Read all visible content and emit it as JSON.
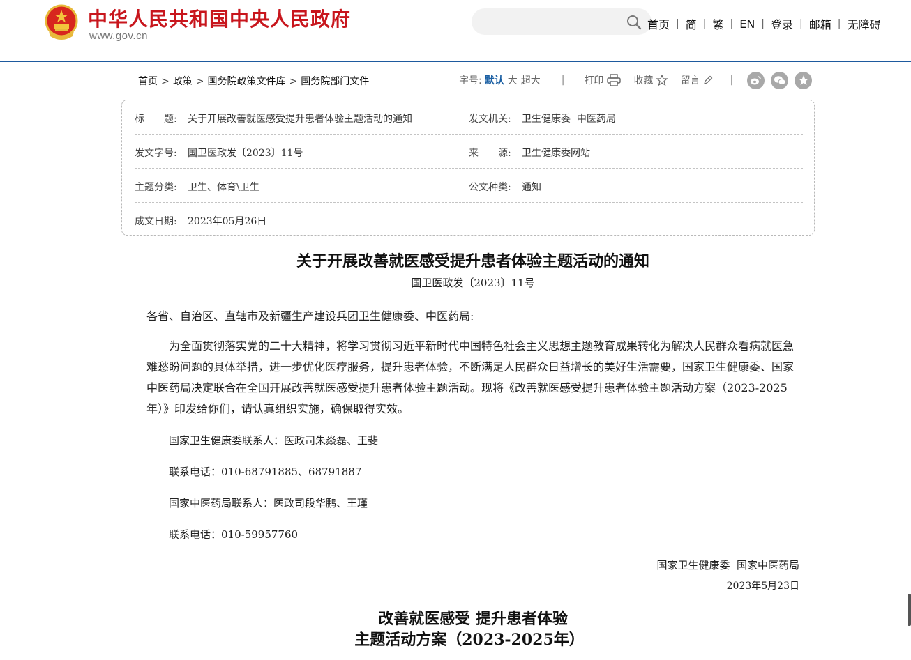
{
  "header": {
    "site_title": "中华人民共和国中央人民政府",
    "site_url": "www.gov.cn",
    "search": {
      "placeholder": ""
    },
    "nav": [
      {
        "label": "首页"
      },
      {
        "label": "简"
      },
      {
        "label": "繁"
      },
      {
        "label": "EN"
      },
      {
        "label": "登录"
      },
      {
        "label": "邮箱"
      },
      {
        "label": "无障碍"
      }
    ]
  },
  "breadcrumb": [
    "首页",
    "政策",
    "国务院政策文件库",
    "国务院部门文件"
  ],
  "toolbar": {
    "font_size_label": "字号:",
    "font_default": "默认",
    "font_large": "大",
    "font_xlarge": "超大",
    "print_label": "打印",
    "favorite_label": "收藏",
    "comment_label": "留言"
  },
  "info": {
    "title_label": "标　　题:",
    "title_value": "关于开展改善就医感受提升患者体验主题活动的通知",
    "issuer_label": "发文机关:",
    "issuer_value": "卫生健康委  中医药局",
    "doc_no_label": "发文字号:",
    "doc_no_value": "国卫医政发〔2023〕11号",
    "source_label": "来　　源:",
    "source_value": "卫生健康委网站",
    "category_label": "主题分类:",
    "category_value": "卫生、体育\\卫生",
    "doc_type_label": "公文种类:",
    "doc_type_value": "通知",
    "date_label": "成文日期:",
    "date_value": "2023年05月26日"
  },
  "article": {
    "title": "关于开展改善就医感受提升患者体验主题活动的通知",
    "doc_number": "国卫医政发〔2023〕11号",
    "salutation": "各省、自治区、直辖市及新疆生产建设兵团卫生健康委、中医药局:",
    "body": "为全面贯彻落实党的二十大精神，将学习贯彻习近平新时代中国特色社会主义思想主题教育成果转化为解决人民群众看病就医急难愁盼问题的具体举措，进一步优化医疗服务，提升患者体验，不断满足人民群众日益增长的美好生活需要，国家卫生健康委、国家中医药局决定联合在全国开展改善就医感受提升患者体验主题活动。现将《改善就医感受提升患者体验主题活动方案（2023-2025年）》印发给你们，请认真组织实施，确保取得实效。",
    "contacts": [
      "国家卫生健康委联系人：医政司朱焱磊、王斐",
      "联系电话：010-68791885、68791887",
      "国家中医药局联系人：医政司段华鹏、王瑾",
      "联系电话：010-59957760"
    ],
    "signature_org": "国家卫生健康委  国家中医药局",
    "signature_date": "2023年5月23日",
    "plan_title_line1": "改善就医感受 提升患者体验",
    "plan_title_line2": "主题活动方案（2023-2025年）"
  },
  "colors": {
    "brand_red": "#c8161d",
    "link_blue": "#1a5fa3",
    "header_rule": "#1e5a9e"
  }
}
